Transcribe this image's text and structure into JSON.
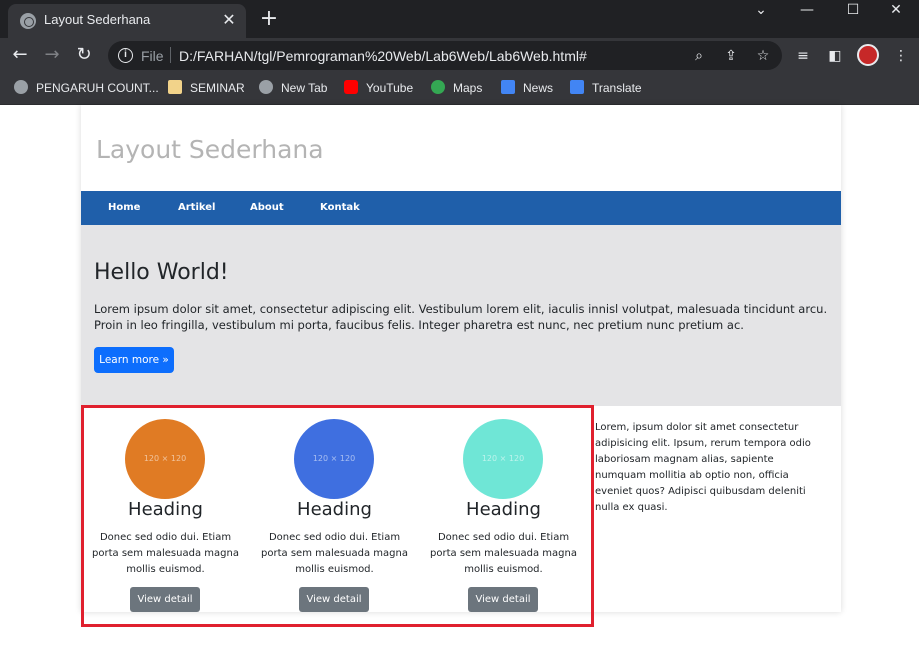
{
  "browser": {
    "tab_title": "Layout Sederhana",
    "tab_close": "✕",
    "new_tab": "+",
    "window_controls": [
      "⌄",
      "—",
      "☐",
      "✕"
    ],
    "url_scheme": "File",
    "url": "D:/FARHAN/tgl/Pemrograman%20Web/Lab6Web/Lab6Web.html#",
    "bookmarks": [
      {
        "label": "PENGARUH COUNT...",
        "icon": "globe-icon",
        "color": "#9aa0a6"
      },
      {
        "label": "SEMINAR",
        "icon": "folder-icon",
        "color": "#f2d38a"
      },
      {
        "label": "New Tab",
        "icon": "globe-icon",
        "color": "#9aa0a6"
      },
      {
        "label": "YouTube",
        "icon": "youtube-icon",
        "color": "#ff0000"
      },
      {
        "label": "Maps",
        "icon": "maps-icon",
        "color": "#34a853"
      },
      {
        "label": "News",
        "icon": "news-icon",
        "color": "#4285f4"
      },
      {
        "label": "Translate",
        "icon": "translate-icon",
        "color": "#4285f4"
      }
    ]
  },
  "site": {
    "title": "Layout Sederhana",
    "nav": [
      "Home",
      "Artikel",
      "About",
      "Kontak"
    ],
    "hero": {
      "heading": "Hello World!",
      "text": "Lorem ipsum dolor sit amet, consectetur adipiscing elit. Vestibulum lorem elit, iaculis innisl volutpat, malesuada tincidunt arcu. Proin in leo fringilla, vestibulum mi porta, faucibus felis. Integer pharetra est nunc, nec pretium nunc pretium ac.",
      "button": "Learn more »"
    },
    "cards": [
      {
        "image_text": "120 × 120",
        "color": "#e07b24",
        "heading": "Heading",
        "text": "Donec sed odio dui. Etiam porta sem malesuada magna mollis euismod.",
        "button": "View detail"
      },
      {
        "image_text": "120 × 120",
        "color": "#3f6fe0",
        "heading": "Heading",
        "text": "Donec sed odio dui. Etiam porta sem malesuada magna mollis euismod.",
        "button": "View detail"
      },
      {
        "image_text": "120 × 120",
        "color": "#6fe6d6",
        "heading": "Heading",
        "text": "Donec sed odio dui. Etiam porta sem malesuada magna mollis euismod.",
        "button": "View detail"
      }
    ],
    "sidebar_text": "Lorem, ipsum dolor sit amet consectetur adipisicing elit. Ipsum, rerum tempora odio laboriosam magnam alias, sapiente numquam mollitia ab optio non, officia eveniet quos? Adipisci quibusdam deleniti nulla ex quasi."
  },
  "colors": {
    "navbar": "#1f5faa",
    "hero_bg": "#e4e4e6",
    "primary_button": "#0d6efd",
    "secondary_button": "#6c757d",
    "highlight_border": "#e0202e"
  }
}
